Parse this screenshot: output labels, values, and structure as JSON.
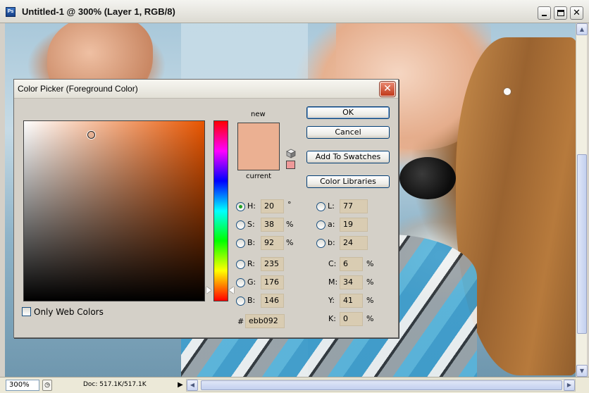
{
  "window": {
    "title": "Untitled-1 @ 300% (Layer 1, RGB/8)",
    "app_icon_text": "Ps"
  },
  "statusbar": {
    "zoom": "300%",
    "doc_info": "Doc: 517.1K/517.1K"
  },
  "dialog": {
    "title": "Color Picker (Foreground Color)",
    "new_label": "new",
    "current_label": "current",
    "new_color": "#ebb092",
    "web_safe_color": "#ee9999",
    "buttons": {
      "ok": "OK",
      "cancel": "Cancel",
      "add_to_swatches": "Add To Swatches",
      "color_libraries": "Color Libraries"
    },
    "hsb": {
      "h_label": "H:",
      "h_value": "20",
      "h_unit": "°",
      "s_label": "S:",
      "s_value": "38",
      "s_unit": "%",
      "b_label": "B:",
      "b_value": "92",
      "b_unit": "%",
      "selected": "H"
    },
    "rgb": {
      "r_label": "R:",
      "r_value": "235",
      "g_label": "G:",
      "g_value": "176",
      "b_label": "B:",
      "b_value": "146"
    },
    "lab": {
      "l_label": "L:",
      "l_value": "77",
      "a_label": "a:",
      "a_value": "19",
      "b_label": "b:",
      "b_value": "24"
    },
    "cmyk": {
      "c_label": "C:",
      "c_value": "6",
      "c_unit": "%",
      "m_label": "M:",
      "m_value": "34",
      "m_unit": "%",
      "y_label": "Y:",
      "y_value": "41",
      "y_unit": "%",
      "k_label": "K:",
      "k_value": "0",
      "k_unit": "%"
    },
    "hex": {
      "label": "#",
      "value": "ebb092"
    },
    "only_web_colors": {
      "label": "Only Web Colors",
      "checked": false
    }
  }
}
